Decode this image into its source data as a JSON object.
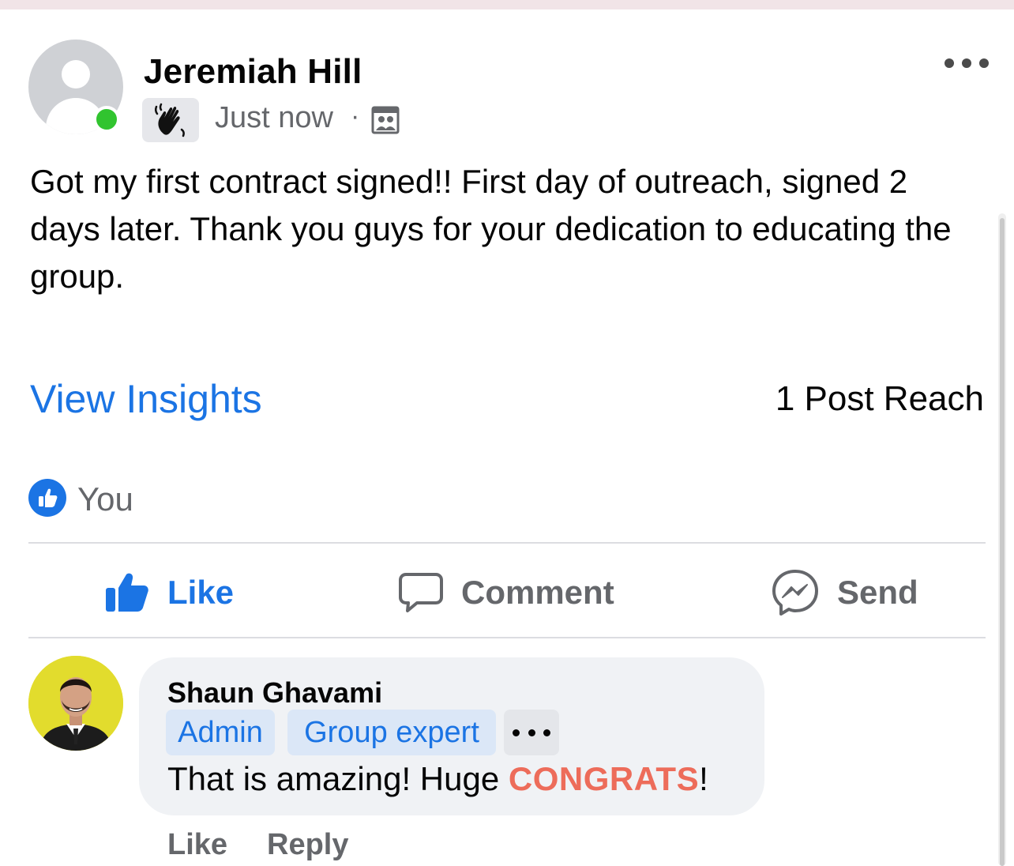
{
  "post": {
    "author": "Jeremiah Hill",
    "time": "Just now",
    "separator": "·",
    "badge_icon": "waving-hand-icon",
    "audience_icon": "group-members-icon",
    "text": "Got my first contract signed!! First day of outreach, signed 2 days later. Thank you guys for your dedication to educating the group.",
    "insights_link": "View Insights",
    "reach": "1 Post Reach",
    "reactions": {
      "icon": "like-icon",
      "names": "You"
    }
  },
  "actions": {
    "like": "Like",
    "comment": "Comment",
    "send": "Send"
  },
  "comment": {
    "author": "Shaun Ghavami",
    "badges": [
      "Admin",
      "Group expert"
    ],
    "text_before": "That is amazing! Huge ",
    "highlight": "CONGRATS",
    "text_after": "!",
    "like": "Like",
    "reply": "Reply"
  },
  "colors": {
    "accent": "#1b74e4",
    "online": "#31c42f",
    "highlight": "#ed6c5a",
    "secondary_text": "#65676b"
  }
}
